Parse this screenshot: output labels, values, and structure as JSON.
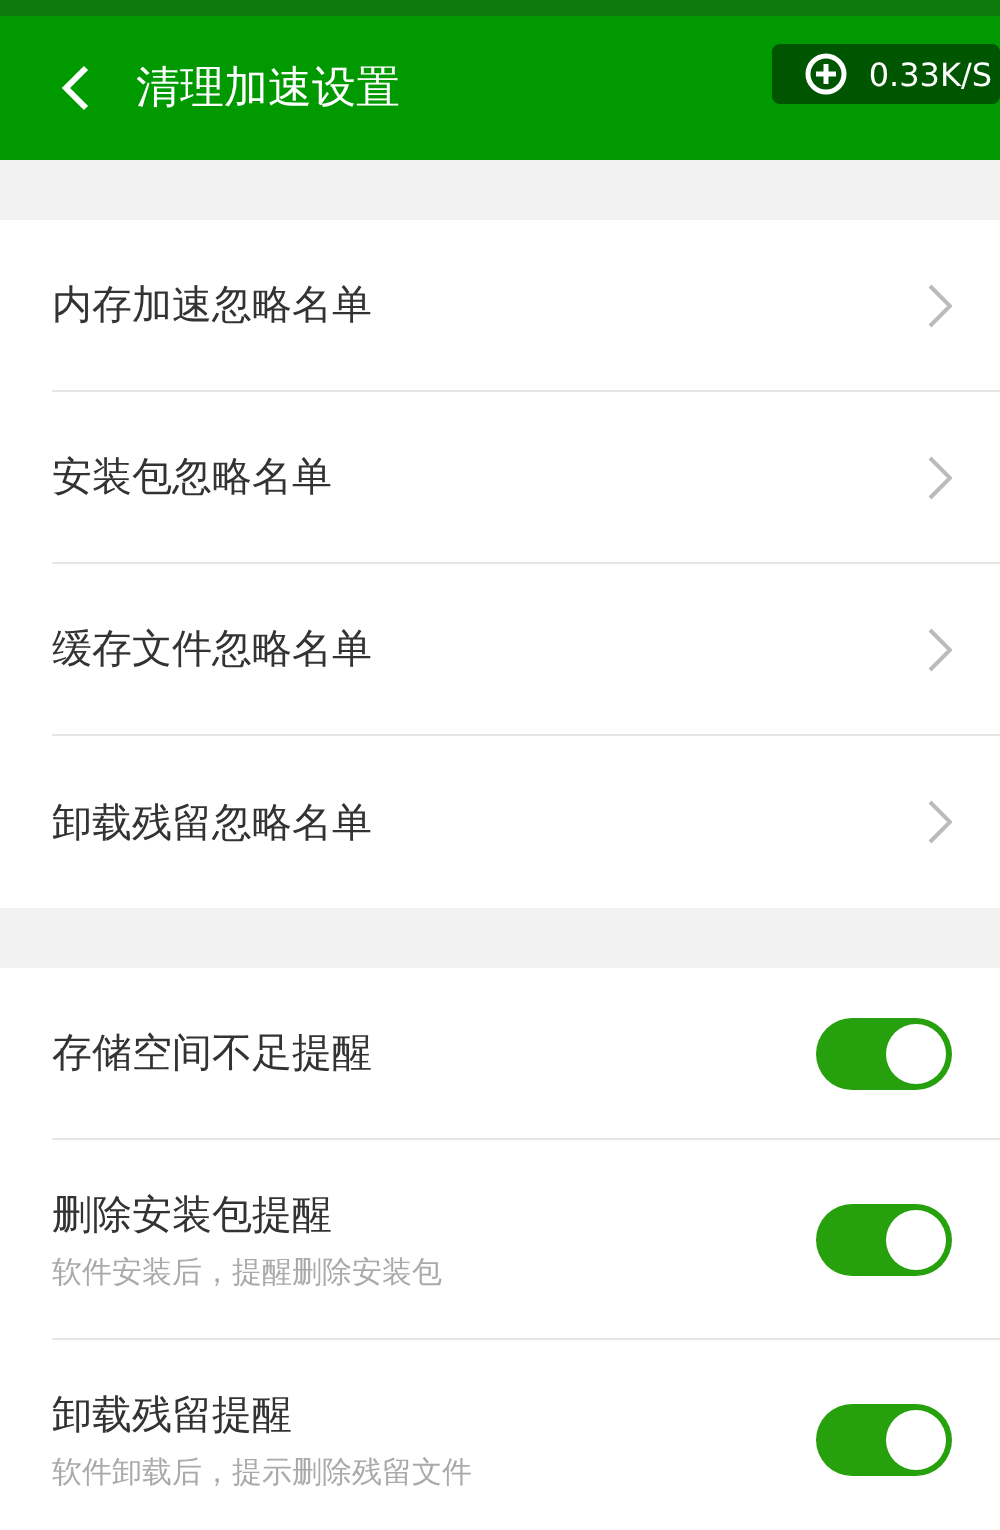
{
  "header": {
    "title": "清理加速设置",
    "speed": "0.33K/S"
  },
  "ignore_lists": [
    {
      "label": "内存加速忽略名单"
    },
    {
      "label": "安装包忽略名单"
    },
    {
      "label": "缓存文件忽略名单"
    },
    {
      "label": "卸载残留忽略名单"
    }
  ],
  "reminders": [
    {
      "label": "存储空间不足提醒",
      "on": true
    },
    {
      "label": "删除安装包提醒",
      "description": "软件安装后，提醒删除安装包",
      "on": true
    },
    {
      "label": "卸载残留提醒",
      "description": "软件卸载后，提示删除残留文件",
      "on": true
    }
  ]
}
